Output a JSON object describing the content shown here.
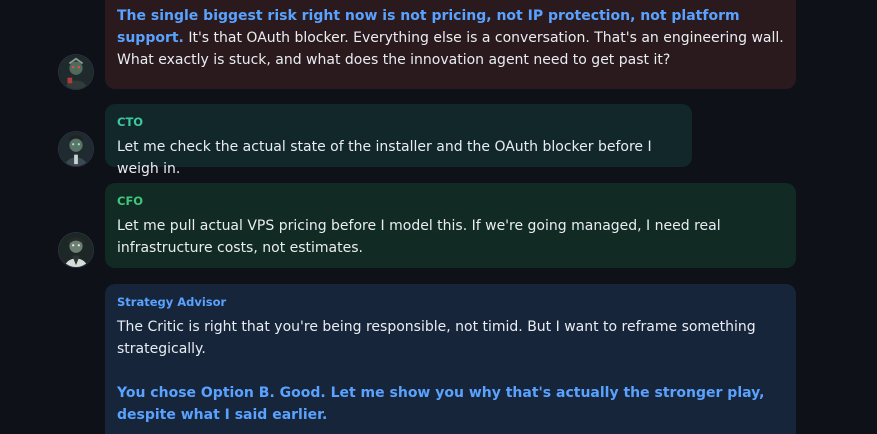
{
  "messages": [
    {
      "sender": "",
      "highlight": "The single biggest risk right now is not pricing, not IP protection, not platform support.",
      "text": " It's that OAuth blocker. Everything else is a conversation. That's an engineering wall. What exactly is stuck, and what does the innovation agent need to get past it?",
      "avatar": "character-avatar-icon"
    },
    {
      "sender": "CTO",
      "text": "Let me check the actual state of the installer and the OAuth blocker before I weigh in.",
      "avatar": "cto-avatar-icon"
    },
    {
      "sender": "CFO",
      "text": "Let me pull actual VPS pricing before I model this. If we're going managed, I need real infrastructure costs, not estimates.",
      "avatar": "cfo-avatar-icon"
    },
    {
      "sender": "Strategy Advisor",
      "text": "The Critic is right that you're being responsible, not timid. But I want to reframe something strategically.",
      "highlight": "You chose Option B. Good. Let me show you why that's actually the stronger play, despite what I said earlier."
    }
  ],
  "colors": {
    "background": "#0e1117",
    "accent_blue": "#5aa2ff",
    "cto_label": "#3ec8a0",
    "cfo_label": "#3fc77a",
    "critic_bubble": "#2a1a1d",
    "cto_bubble": "#11272a",
    "cfo_bubble": "#112a24",
    "strategy_bubble": "#16253a"
  }
}
